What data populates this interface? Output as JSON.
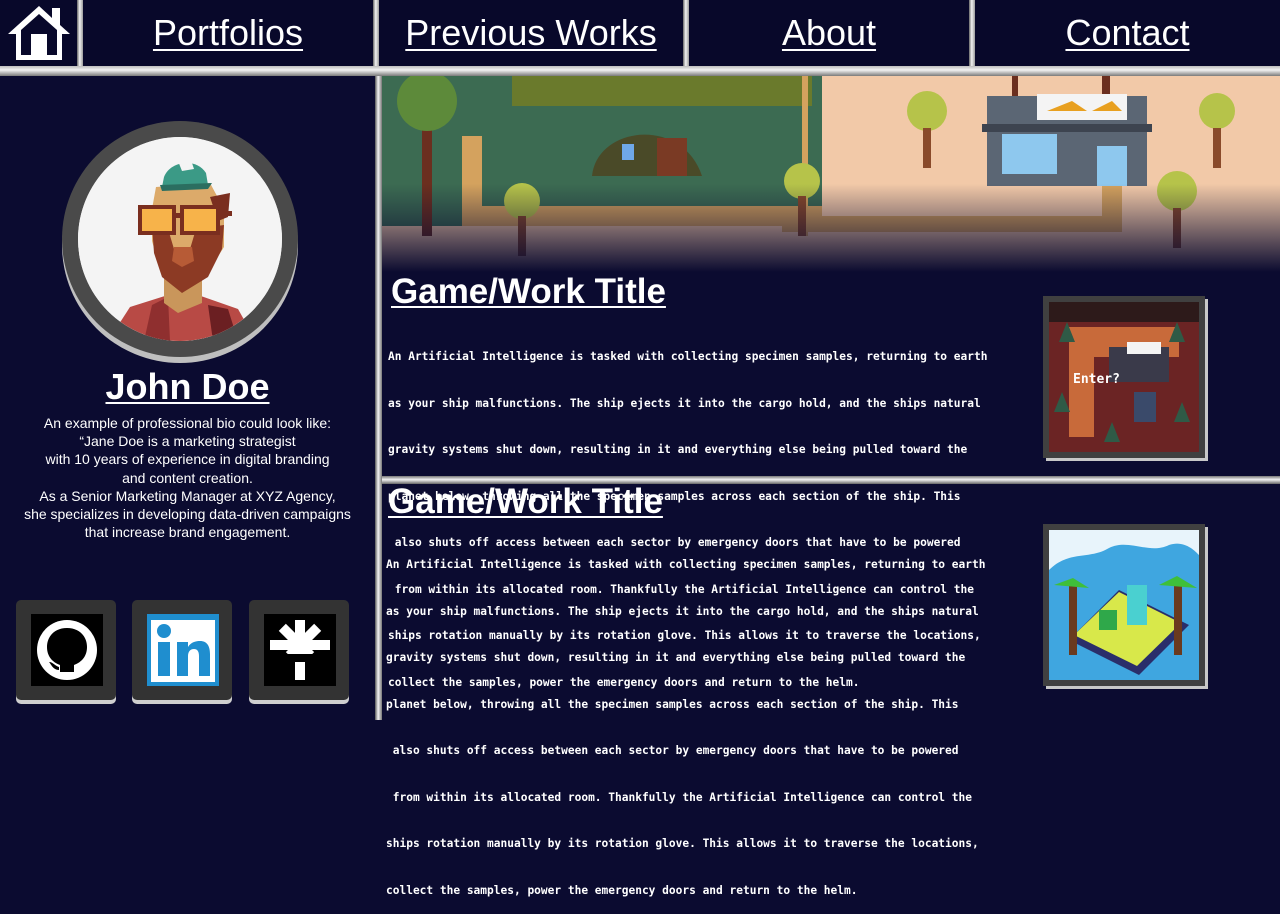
{
  "nav": {
    "home_icon": "home-icon",
    "links": [
      {
        "label": "Portfolios"
      },
      {
        "label": "Previous Works"
      },
      {
        "label": "About"
      },
      {
        "label": "Contact"
      }
    ]
  },
  "profile": {
    "name": "John Doe",
    "avatar_icon": "avatar",
    "bio_lines": [
      "An example of professional bio could look like:",
      "“Jane Doe is a marketing strategist",
      "with 10 years of experience in digital branding",
      "and content creation.",
      "As a Senior Marketing Manager at XYZ Agency,",
      "she specializes in developing data-driven campaigns",
      "that increase brand engagement."
    ],
    "socials": [
      {
        "icon": "github-icon"
      },
      {
        "icon": "linkedin-icon"
      },
      {
        "icon": "linktree-icon"
      }
    ]
  },
  "works": [
    {
      "title": "Game/Work Title",
      "description_lines": [
        "An Artificial Intelligence is tasked with collecting specimen samples, returning to earth",
        "as your ship malfunctions. The ship ejects it into the cargo hold, and the ships natural",
        "gravity systems shut down, resulting in it and everything else being pulled toward the",
        "planet below, throwing all the specimen samples across each section of the ship. This",
        " also shuts off access between each sector by emergency doors that have to be powered",
        " from within its allocated room. Thankfully the Artificial Intelligence can control the",
        "ships rotation manually by its rotation glove. This allows it to traverse the locations,",
        "collect the samples, power the emergency doors and return to the helm."
      ],
      "thumb_text": "Enter?"
    },
    {
      "title": "Game/Work Title",
      "description_lines": [
        "An Artificial Intelligence is tasked with collecting specimen samples, returning to earth",
        "as your ship malfunctions. The ship ejects it into the cargo hold, and the ships natural",
        "gravity systems shut down, resulting in it and everything else being pulled toward the",
        "planet below, throwing all the specimen samples across each section of the ship. This",
        " also shuts off access between each sector by emergency doors that have to be powered",
        " from within its allocated room. Thankfully the Artificial Intelligence can control the",
        "ships rotation manually by its rotation glove. This allows it to traverse the locations,",
        "collect the samples, power the emergency doors and return to the helm."
      ]
    }
  ]
}
